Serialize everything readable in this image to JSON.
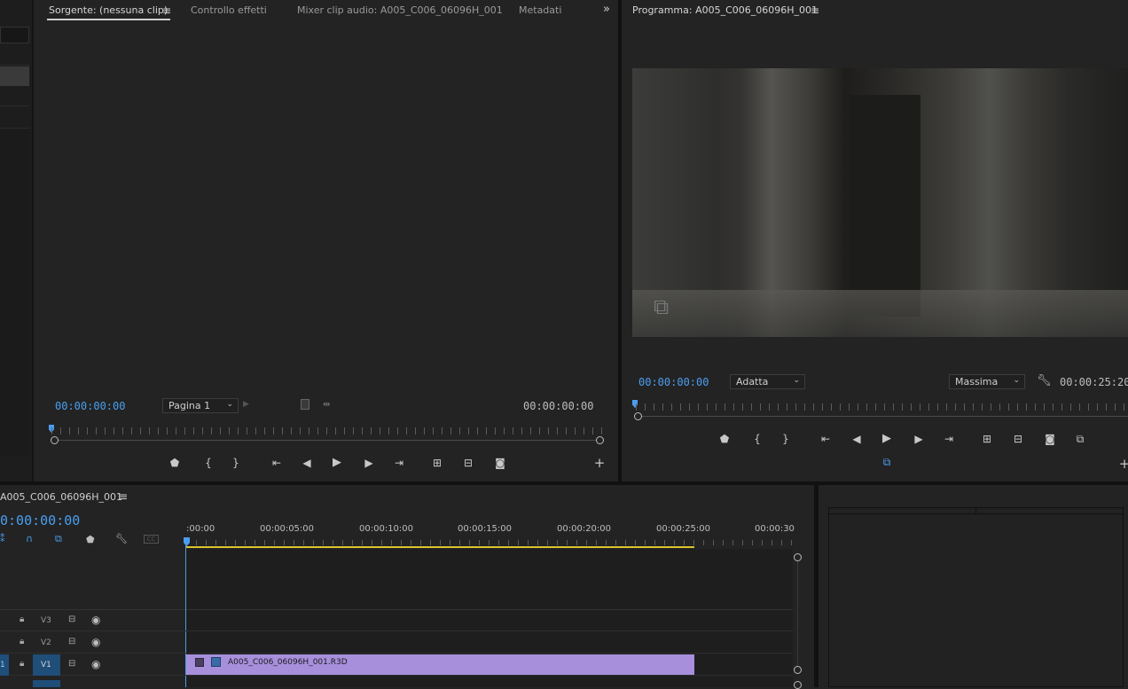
{
  "source_panel": {
    "tabs": [
      "Sorgente: (nessuna clip)",
      "Controllo effetti",
      "Mixer clip audio: A005_C006_06096H_001",
      "Metadati"
    ],
    "menu_icon": "hamburger-icon",
    "overflow_icon": "double-chevron-right-icon",
    "timecode_left": "00:00:00:00",
    "timecode_right": "00:00:00:00",
    "page_select": "Pagina 1"
  },
  "program_panel": {
    "title": "Programma: A005_C006_06096H_001",
    "timecode_left": "00:00:00:00",
    "timecode_right": "00:00:25:20",
    "fit_select": "Adatta",
    "quality_select": "Massima"
  },
  "timeline": {
    "title": "A005_C006_06096H_001",
    "timecode": "0:00:00:00",
    "ruler_labels": [
      ":00:00",
      "00:00:05:00",
      "00:00:10:00",
      "00:00:15:00",
      "00:00:20:00",
      "00:00:25:00",
      "00:00:30"
    ],
    "tracks": [
      {
        "name": "V3"
      },
      {
        "name": "V2"
      },
      {
        "name": "V1"
      }
    ],
    "clip_name": "A005_C006_06096H_001.R3D",
    "clip_color": "#a78fdc",
    "in_out_color": "#d8c52a",
    "accent": "#4a9ef0"
  }
}
